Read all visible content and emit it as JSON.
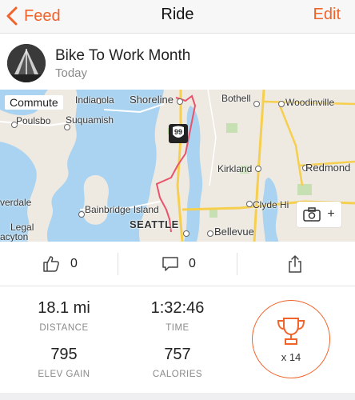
{
  "nav": {
    "back_label": "Feed",
    "title": "Ride",
    "edit_label": "Edit"
  },
  "activity": {
    "title": "Bike To Work Month",
    "date": "Today"
  },
  "map": {
    "tag": "Commute",
    "labels": {
      "indianola": "Indianola",
      "shoreline": "Shoreline",
      "bothell": "Bothell",
      "woodinville": "Woodinville",
      "poulsbo": "Poulsbo",
      "suquamish": "Suquamish",
      "kirkland": "Kirkland",
      "redmond": "Redmond",
      "verdale": "verdale",
      "bainbridge": "Bainbridge Island",
      "clyde_hill": "Clyde Hi",
      "seattle": "SEATTLE",
      "legal": "Legal",
      "acyton": "acyton",
      "bellevue": "Bellevue",
      "highway": "99"
    },
    "add_photo_plus": "+"
  },
  "actions": {
    "kudos_count": "0",
    "comments_count": "0"
  },
  "stats": {
    "distance": {
      "value": "18.1 mi",
      "label": "DISTANCE"
    },
    "time": {
      "value": "1:32:46",
      "label": "TIME"
    },
    "elev_gain": {
      "value": "795",
      "label": "ELEV GAIN"
    },
    "calories": {
      "value": "757",
      "label": "CALORIES"
    },
    "achievements": {
      "count": "x 14"
    }
  },
  "colors": {
    "accent": "#f0632a",
    "water": "#a9d3f0",
    "land": "#eeeae2",
    "route": "#e8536a"
  },
  "icons": [
    "chevron-left-icon",
    "route-avatar",
    "camera-icon",
    "thumbs-up-icon",
    "comment-icon",
    "share-icon",
    "trophy-icon",
    "highway-shield-icon"
  ]
}
